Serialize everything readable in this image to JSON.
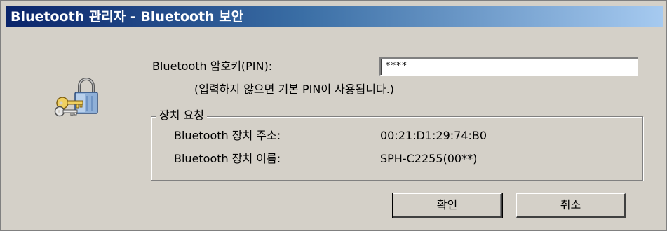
{
  "window": {
    "title": "Bluetooth 관리자 - Bluetooth 보안"
  },
  "pin": {
    "label": "Bluetooth 암호키(PIN):",
    "value": "****",
    "hint": "(입력하지 않으면 기본 PIN이 사용됩니다.)"
  },
  "device_request": {
    "legend": "장치 요청",
    "address_label": "Bluetooth 장치 주소:",
    "address_value": "00:21:D1:29:74:B0",
    "name_label": "Bluetooth 장치 이름:",
    "name_value": "SPH-C2255(00**)"
  },
  "buttons": {
    "ok": "확인",
    "cancel": "취소"
  },
  "icons": {
    "security": "padlock-keys-icon"
  },
  "colors": {
    "titlebar_start": "#0a246a",
    "titlebar_end": "#a6caf0",
    "dialog_bg": "#d4d0c8"
  }
}
